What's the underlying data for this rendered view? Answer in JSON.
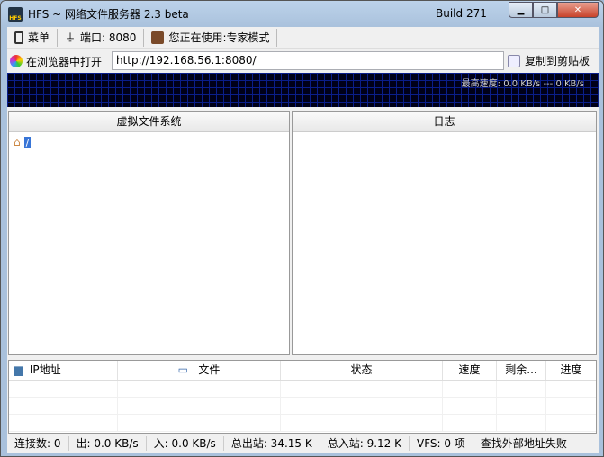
{
  "window": {
    "title": "HFS ~ 网络文件服务器 2.3 beta",
    "build": "Build 271",
    "logo_text": "HFS"
  },
  "toolbar": {
    "menu": "菜单",
    "port": "端口: 8080",
    "mode": "您正在使用:专家模式"
  },
  "address": {
    "open_browser": "在浏览器中打开",
    "url": "http://192.168.56.1:8080/",
    "copy": "复制到剪贴板"
  },
  "graph": {
    "max_speed": "最高速度: 0.0 KB/s --- 0 KB/s"
  },
  "vfs": {
    "header": "虚拟文件系统",
    "root": "/"
  },
  "log": {
    "header": "日志"
  },
  "connections": {
    "columns": [
      "IP地址",
      "文件",
      "状态",
      "速度",
      "剩余...",
      "进度"
    ]
  },
  "status": [
    "连接数: 0",
    "出: 0.0 KB/s",
    "入: 0.0 KB/s",
    "总出站: 34.15 K",
    "总入站: 9.12 K",
    "VFS: 0 项",
    "查找外部地址失败"
  ]
}
